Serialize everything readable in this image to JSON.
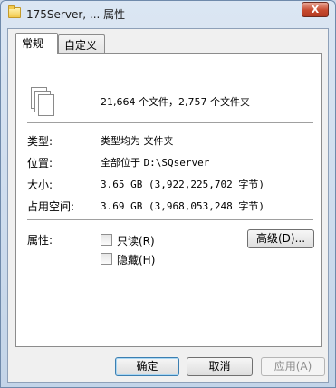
{
  "window": {
    "title": "175Server, ... 属性",
    "close_label": "X"
  },
  "tabs": [
    {
      "label": "常规"
    },
    {
      "label": "自定义"
    }
  ],
  "summary": "21,664 个文件，2,757 个文件夹",
  "fields": {
    "type": {
      "label": "类型:",
      "value": "类型均为 文件夹"
    },
    "location": {
      "label": "位置:",
      "value_prefix": "全部位于",
      "value_path": "D:\\SQserver"
    },
    "size": {
      "label": "大小:",
      "value": "3.65 GB (3,922,225,702 字节)"
    },
    "size_on_disk": {
      "label": "占用空间:",
      "value": "3.69 GB (3,968,053,248 字节)"
    }
  },
  "attributes": {
    "label": "属性:",
    "read_only": {
      "label": "只读(R)",
      "checked": false
    },
    "hidden": {
      "label": "隐藏(H)",
      "checked": false
    },
    "advanced_label": "高级(D)..."
  },
  "buttons": {
    "ok": "确定",
    "cancel": "取消",
    "apply": "应用(A)"
  }
}
